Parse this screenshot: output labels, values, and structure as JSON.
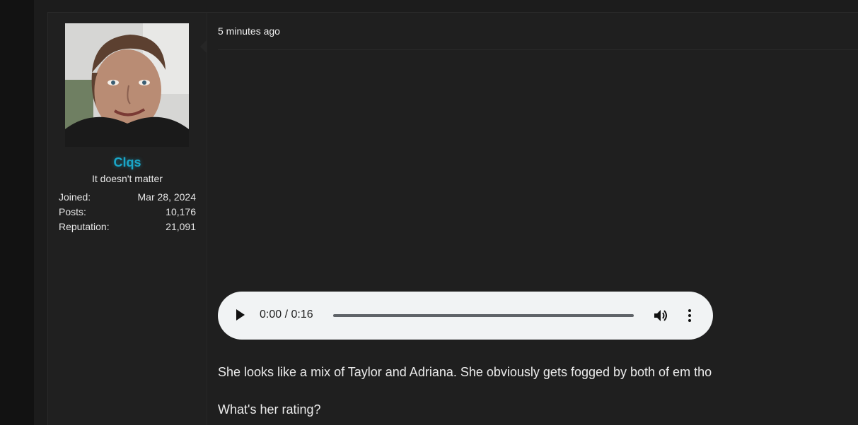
{
  "user": {
    "username": "Clqs",
    "title": "It doesn't matter",
    "stats": [
      {
        "label": "Joined:",
        "value": "Mar 28, 2024"
      },
      {
        "label": "Posts:",
        "value": "10,176"
      },
      {
        "label": "Reputation:",
        "value": "21,091"
      }
    ],
    "username_color": "#1aa6c8"
  },
  "post": {
    "timestamp": "5 minutes ago",
    "audio": {
      "time": "0:00 / 0:16"
    },
    "paragraphs": [
      "She looks like a mix of Taylor and Adriana. She obviously gets fogged by both of em tho",
      "What's her rating?"
    ]
  },
  "icons": {
    "play": "play-icon",
    "volume": "volume-icon",
    "more": "more-vertical-icon"
  }
}
